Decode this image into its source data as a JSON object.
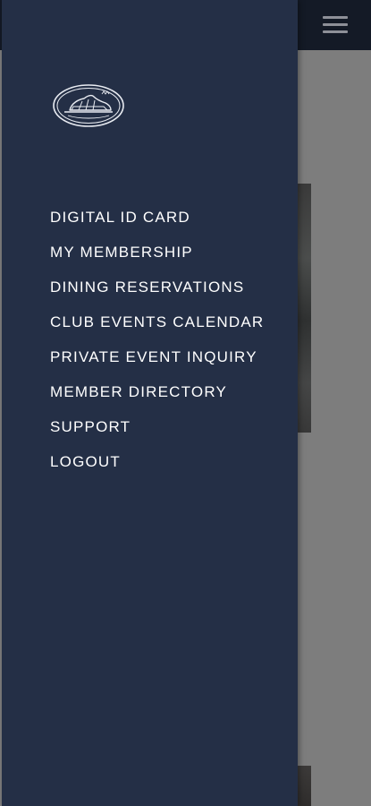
{
  "drawer": {
    "logo": "club-logo",
    "items": [
      {
        "label": "DIGITAL ID CARD"
      },
      {
        "label": "MY MEMBERSHIP"
      },
      {
        "label": "DINING RESERVATIONS"
      },
      {
        "label": "CLUB EVENTS CALENDAR"
      },
      {
        "label": "PRIVATE EVENT INQUIRY"
      },
      {
        "label": "MEMBER DIRECTORY"
      },
      {
        "label": "SUPPORT"
      },
      {
        "label": "LOGOUT"
      }
    ]
  },
  "header": {
    "menu_icon": "hamburger-menu-icon"
  },
  "colors": {
    "drawer_bg": "#242f46",
    "header_bg": "#141a26",
    "overlay_bg": "#7d7d7d",
    "text": "#ffffff"
  }
}
